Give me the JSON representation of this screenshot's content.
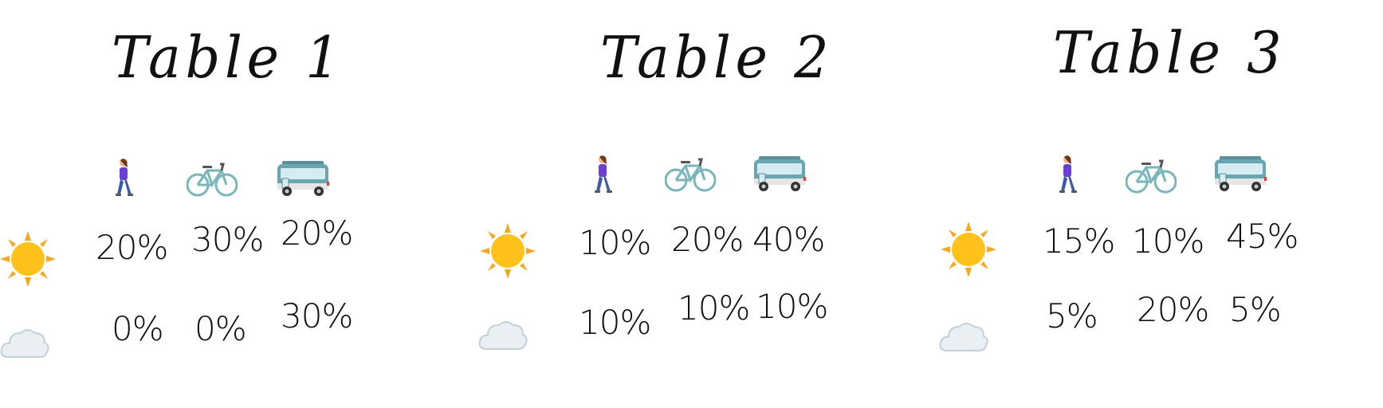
{
  "tables": [
    {
      "title": "Table 1",
      "rows": [
        {
          "weather": "sun-icon",
          "values": [
            "20%",
            "30%",
            "20%"
          ]
        },
        {
          "weather": "cloud-icon",
          "values": [
            "0%",
            "0%",
            "30%"
          ]
        }
      ]
    },
    {
      "title": "Table 2",
      "rows": [
        {
          "weather": "sun-icon",
          "values": [
            "10%",
            "20%",
            "40%"
          ]
        },
        {
          "weather": "cloud-icon",
          "values": [
            "10%",
            "10%",
            "10%"
          ]
        }
      ]
    },
    {
      "title": "Table 3",
      "rows": [
        {
          "weather": "sun-icon",
          "values": [
            "15%",
            "10%",
            "45%"
          ]
        },
        {
          "weather": "cloud-icon",
          "values": [
            "5%",
            "20%",
            "5%"
          ]
        }
      ]
    }
  ],
  "columns": [
    "walking-person-icon",
    "bicycle-icon",
    "bus-icon"
  ],
  "colors": {
    "ink": "#111111",
    "sun": "#ffc21a",
    "sun_rays": "#f5a623",
    "cloud": "#e9eff3",
    "cloud_edge": "#c3d0d8",
    "bicycle": "#78b6b9",
    "bus_body": "#6aa6b0",
    "person_shirt": "#6a3fd1",
    "person_pants": "#3b5aa8"
  }
}
